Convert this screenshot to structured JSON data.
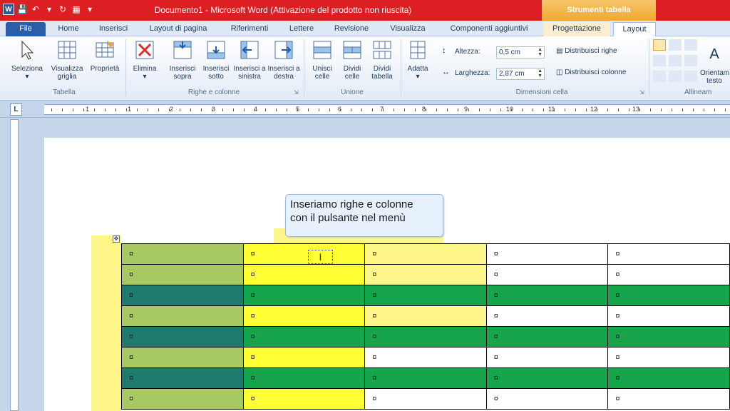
{
  "title_bar": {
    "window_title": "Documento1 - Microsoft Word (Attivazione del prodotto non riuscita)",
    "contextual_tab_header": "Strumenti tabella",
    "app_icon_letter": "W"
  },
  "tabs": [
    {
      "label": "File"
    },
    {
      "label": "Home"
    },
    {
      "label": "Inserisci"
    },
    {
      "label": "Layout di pagina"
    },
    {
      "label": "Riferimenti"
    },
    {
      "label": "Lettere"
    },
    {
      "label": "Revisione"
    },
    {
      "label": "Visualizza"
    },
    {
      "label": "Componenti aggiuntivi"
    },
    {
      "label": "Progettazione"
    },
    {
      "label": "Layout"
    }
  ],
  "ribbon": {
    "tabella": {
      "group_label": "Tabella",
      "buttons": [
        {
          "label": "Seleziona"
        },
        {
          "label": "Visualizza griglia"
        },
        {
          "label": "Proprietà"
        }
      ]
    },
    "righe_colonne": {
      "group_label": "Righe e colonne",
      "buttons": [
        {
          "label": "Elimina"
        },
        {
          "label": "Inserisci sopra"
        },
        {
          "label": "Inserisci sotto"
        },
        {
          "label": "Inserisci a sinistra"
        },
        {
          "label": "Inserisci a destra"
        }
      ]
    },
    "unione": {
      "group_label": "Unione",
      "buttons": [
        {
          "label": "Unisci celle"
        },
        {
          "label": "Dividi celle"
        },
        {
          "label": "Dividi tabella"
        }
      ]
    },
    "dimensioni": {
      "group_label": "Dimensioni cella",
      "adatta_label": "Adatta",
      "height_label": "Altezza:",
      "height_value": "0,5 cm",
      "width_label": "Larghezza:",
      "width_value": "2,87 cm",
      "distribute_rows": "Distribuisci righe",
      "distribute_cols": "Distribuisci colonne"
    },
    "allineamento": {
      "group_label": "Allineam",
      "orientation_label": "Orientam testo"
    }
  },
  "ruler": {
    "numbers": [
      "1",
      "1",
      "2",
      "3",
      "4",
      "5",
      "6",
      "7",
      "8",
      "9",
      "10",
      "11",
      "12",
      "13"
    ],
    "tab_selector": "L"
  },
  "callout": {
    "line1": "Inseriamo righe e colonne",
    "line2": "con il pulsante nel menù"
  },
  "table": {
    "cell_mark": "¤",
    "rows": 8,
    "cols": 5
  },
  "colors": {
    "title_red": "#dd1e23",
    "contextual_orange": "#f0a830",
    "file_tab_blue": "#2a5ea8",
    "green_light": "#a8c864",
    "green_dark": "#1f7b6e",
    "green_row": "#17a54b",
    "yellow": "#ffff33",
    "yellow_hl": "#fff68a"
  }
}
